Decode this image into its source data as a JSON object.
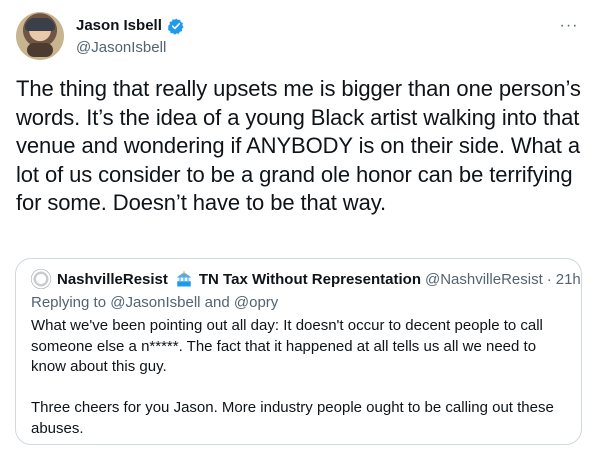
{
  "author": {
    "display_name": "Jason Isbell",
    "handle": "@JasonIsbell"
  },
  "more_label": "···",
  "tweet_text": "The thing that really upsets me is bigger than one person’s words. It’s the idea of a young Black artist walking into that venue and wondering if ANYBODY is on their side. What a lot of us consider to be a grand ole honor can be terrifying for some. Doesn’t have to be that way.",
  "quoted_tweet": {
    "display_name": "NashvilleResist",
    "display_name_suffix": "TN Tax Without Representation",
    "handle": "@NashvilleResist",
    "separator": "·",
    "time": "21h",
    "replying_prefix": "Replying to ",
    "mention_1": "@JasonIsbell",
    "and_word": " and ",
    "mention_2": "@opry",
    "text": "What we've been pointing out all day: It doesn't occur to decent people to call someone else a n*****.  The fact that it happened at all tells us all we need to know about this guy.\n\nThree cheers for you Jason. More industry people ought to be calling out these abuses."
  },
  "colors": {
    "text": "#0f1419",
    "secondary": "#536471",
    "verified": "#1d9bf0",
    "border": "#cfd9de"
  },
  "icons": [
    "verified-badge-icon",
    "more-icon",
    "tax-icon"
  ]
}
